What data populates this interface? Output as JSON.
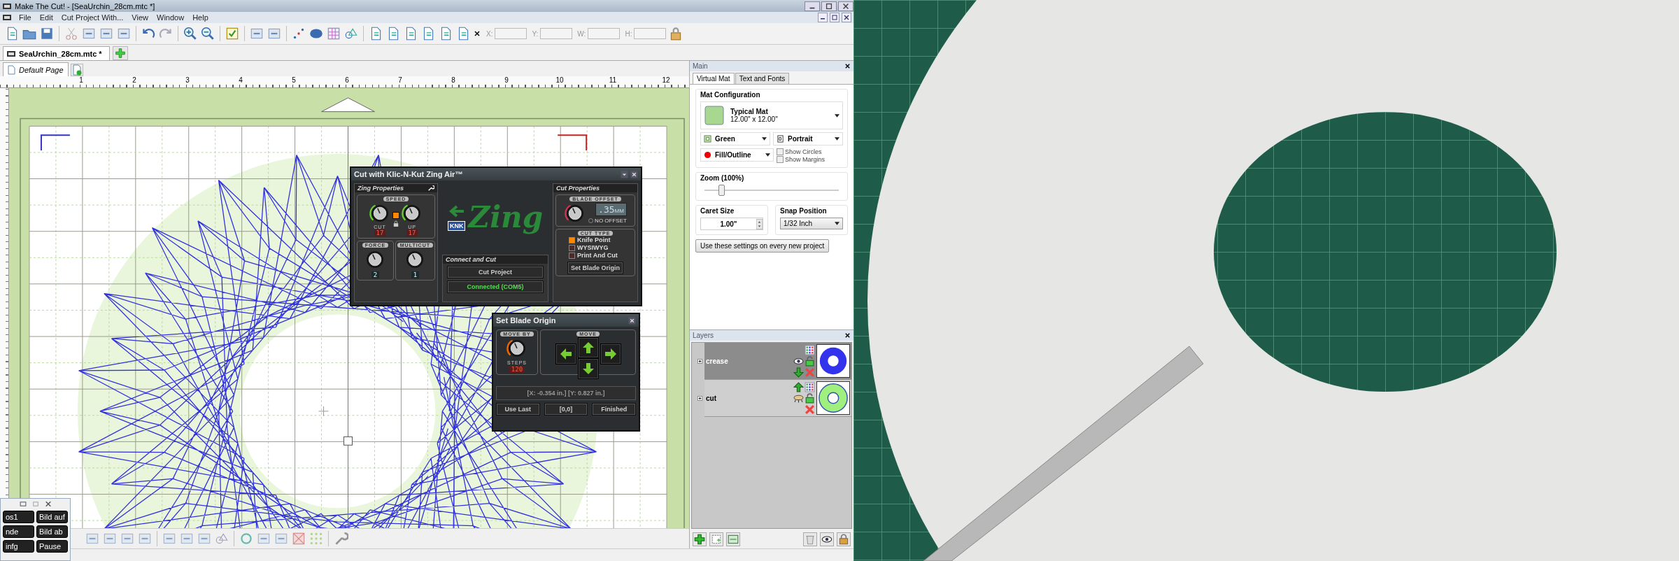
{
  "window": {
    "title": "Make The Cut! - [SeaUrchin_28cm.mtc *]"
  },
  "menu": [
    "File",
    "Edit",
    "Cut Project With...",
    "View",
    "Window",
    "Help"
  ],
  "coordinate_fields": [
    {
      "label": "X:"
    },
    {
      "label": "Y:"
    },
    {
      "label": "W:"
    },
    {
      "label": "H:"
    }
  ],
  "document_tabs": [
    {
      "label": "SeaUrchin_28cm.mtc *",
      "selected": true
    }
  ],
  "page_tabs": [
    {
      "label": "Default Page",
      "selected": true
    }
  ],
  "ruler": {
    "marks": [
      "1",
      "2",
      "3",
      "4",
      "5",
      "6",
      "7",
      "8",
      "9",
      "10",
      "11",
      "12"
    ]
  },
  "main_panel": {
    "title": "Main",
    "tabs": [
      {
        "label": "Virtual Mat",
        "selected": true
      },
      {
        "label": "Text and Fonts",
        "selected": false
      }
    ],
    "mat_configuration": {
      "heading": "Mat Configuration",
      "mat_name": "Typical Mat",
      "mat_size": "12.00\" x 12.00\"",
      "mat_tint": "Green",
      "orientation": "Portrait",
      "display": "Fill/Outline",
      "options": [
        {
          "label": "Show Circles",
          "checked": false
        },
        {
          "label": "Show Margins",
          "checked": false
        }
      ]
    },
    "zoom": {
      "label": "Zoom (100%)",
      "level": 0.12
    },
    "caret_size": {
      "label": "Caret Size",
      "value": "1.00\""
    },
    "snap_position": {
      "label": "Snap Position",
      "value": "1/32 Inch"
    },
    "default_button": "Use these settings on every new project"
  },
  "layers_panel": {
    "title": "Layers",
    "layers": [
      {
        "name": "crease",
        "selected": true,
        "visible": true,
        "kind": "pattern"
      },
      {
        "name": "cut",
        "selected": false,
        "visible": false,
        "kind": "ring"
      }
    ]
  },
  "zing_dialog": {
    "title": "Cut with Klic-N-Kut Zing Air™",
    "zing_properties": {
      "heading": "Zing Properties",
      "speed_label": "SPEED",
      "speed_link": {
        "on": true
      },
      "cut": {
        "label": "CUT",
        "value": "17"
      },
      "up": {
        "label": "UP",
        "value": "17"
      },
      "force": {
        "label": "FORCE",
        "value": "2"
      },
      "multicut": {
        "label": "MULTICUT",
        "value": "1"
      }
    },
    "logo": {
      "badge": "KNK",
      "wordmark": "Zing"
    },
    "connect_and_cut": {
      "heading": "Connect and Cut",
      "cut_button": "Cut Project",
      "status": "Connected (COM5)"
    },
    "cut_properties": {
      "heading": "Cut Properties",
      "blade_offset_label": "BLADE OFFSET",
      "offset_value": ".35",
      "offset_unit": "MM",
      "no_offset": {
        "label": "NO OFFSET",
        "selected": false
      },
      "cut_type_label": "CUT TYPE",
      "cut_types": [
        {
          "label": "Knife Point",
          "selected": true
        },
        {
          "label": "WYSIWYG",
          "selected": false
        },
        {
          "label": "Print And Cut",
          "selected": false
        }
      ],
      "origin_button": "Set Blade Origin"
    }
  },
  "blade_origin_dialog": {
    "title": "Set Blade Origin",
    "move_by_label": "MOVE BY",
    "steps_label": "STEPS",
    "steps_value": "120",
    "move_label": "MOVE",
    "position": "[X: -0.354 in.] [Y: 0.827 in.]",
    "buttons": [
      "Use Last",
      "[0,0]",
      "Finished"
    ]
  },
  "key_window": {
    "keys": [
      "os1",
      "Bild auf",
      "nde",
      "Bild ab",
      "infg",
      "Pause"
    ]
  }
}
